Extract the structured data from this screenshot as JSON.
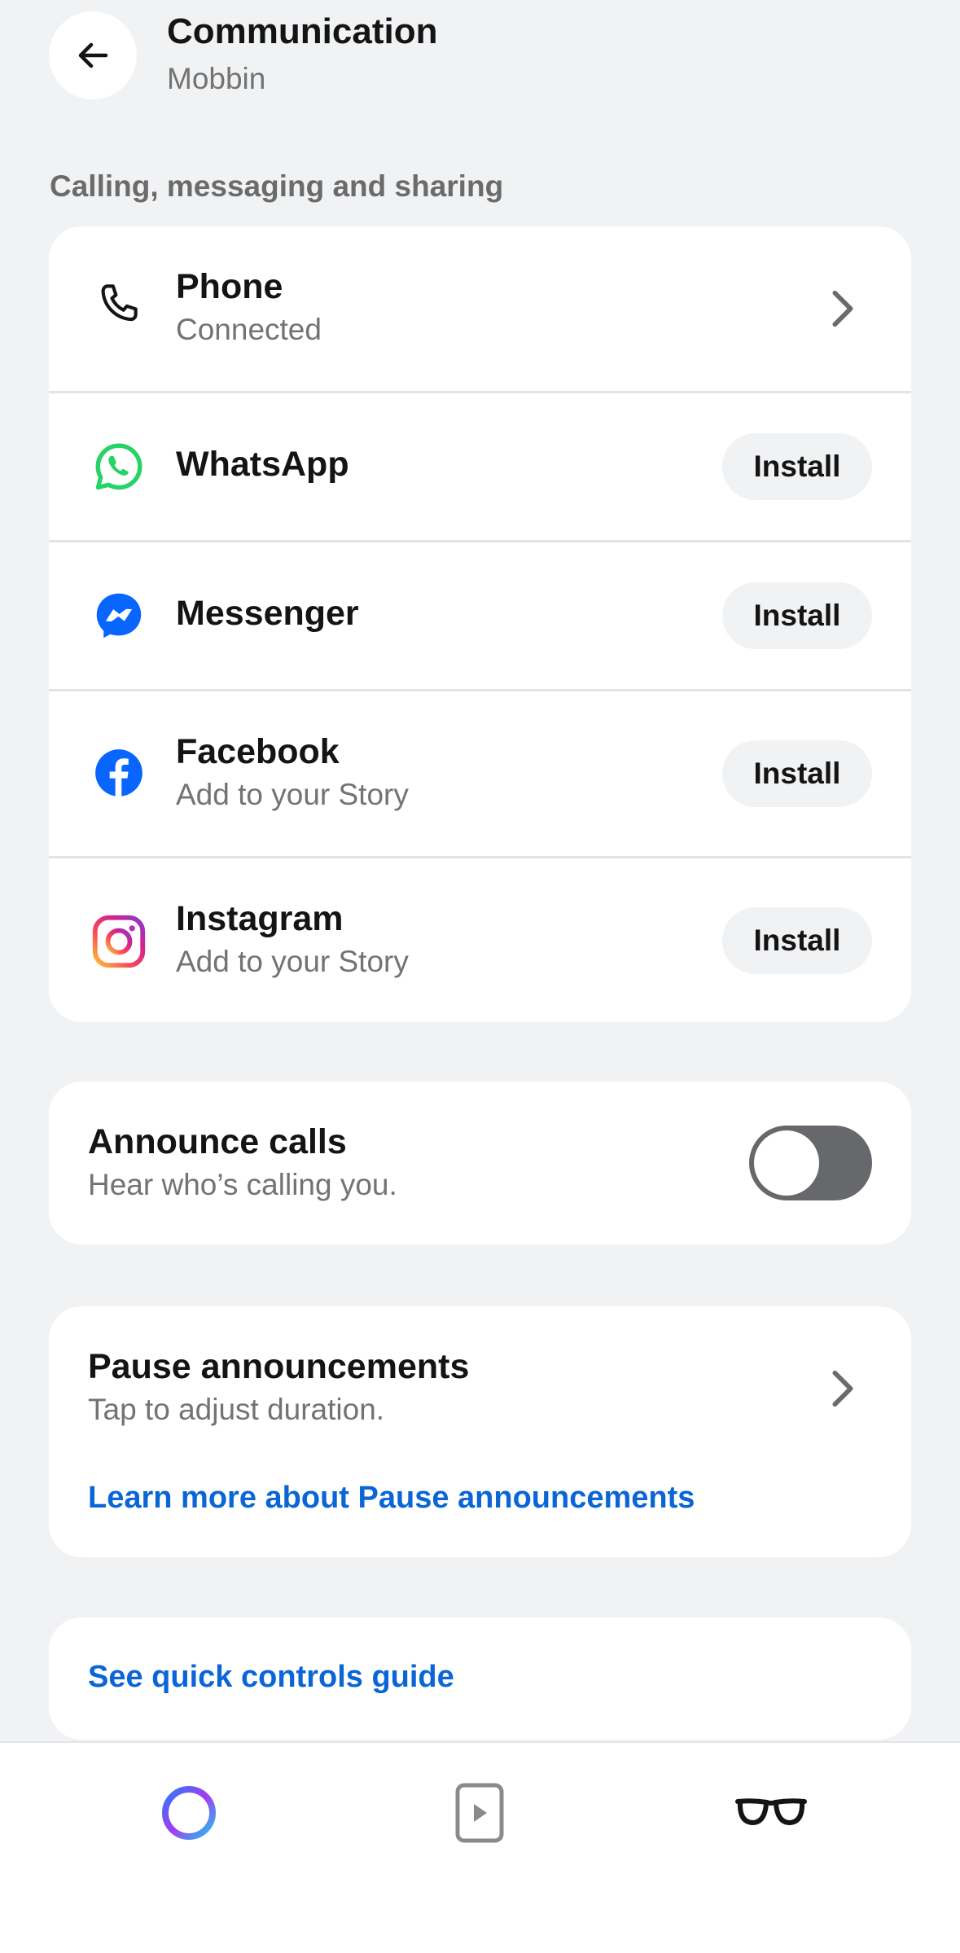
{
  "header": {
    "title": "Communication",
    "subtitle": "Mobbin"
  },
  "section": {
    "label": "Calling, messaging and sharing"
  },
  "apps": [
    {
      "name": "Phone",
      "status": "Connected",
      "icon": "phone-icon",
      "action": "chevron"
    },
    {
      "name": "WhatsApp",
      "icon": "whatsapp-icon",
      "action": "Install"
    },
    {
      "name": "Messenger",
      "icon": "messenger-icon",
      "action": "Install"
    },
    {
      "name": "Facebook",
      "status": "Add to your Story",
      "icon": "facebook-icon",
      "action": "Install"
    },
    {
      "name": "Instagram",
      "status": "Add to your Story",
      "icon": "instagram-icon",
      "action": "Install"
    }
  ],
  "announce_calls": {
    "title": "Announce calls",
    "description": "Hear who’s calling you.",
    "enabled": false
  },
  "pause_announcements": {
    "title": "Pause announcements",
    "description": "Tap to adjust duration.",
    "link": "Learn more about Pause announcements"
  },
  "quick_controls": {
    "link": "See quick controls guide"
  },
  "bottom_nav": [
    {
      "name": "meta-ai",
      "icon": "meta-ai-ring-icon"
    },
    {
      "name": "media",
      "icon": "media-play-icon"
    },
    {
      "name": "glasses",
      "icon": "glasses-icon",
      "active": true
    }
  ],
  "colors": {
    "background": "#f1f2f4",
    "card": "#ffffff",
    "link": "#0a66d6",
    "whatsapp": "#25d366",
    "messenger": "#0866ff",
    "facebook": "#0866ff",
    "toggle_off": "#67686c"
  }
}
